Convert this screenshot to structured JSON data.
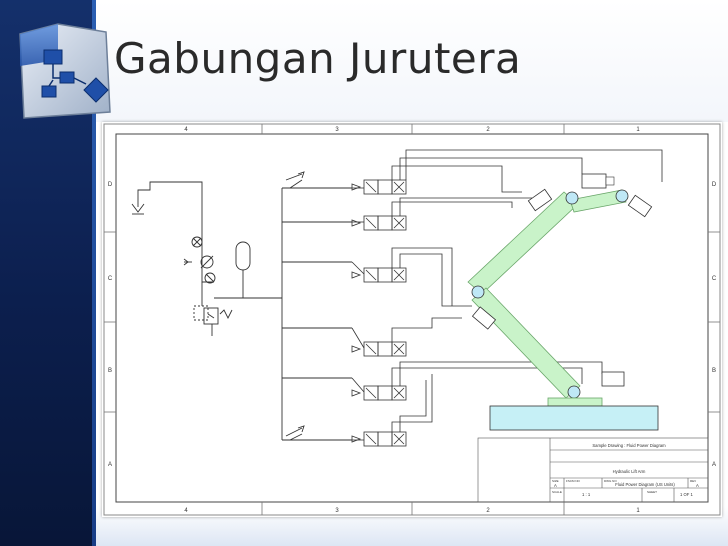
{
  "slide": {
    "title": "Gabungan Jurutera",
    "logo_icon": "diagram-document-icon",
    "accent_color": "#14306b"
  },
  "drawing": {
    "zone_columns": [
      "4",
      "3",
      "2",
      "1"
    ],
    "zone_rows": [
      "D",
      "C",
      "B",
      "A"
    ],
    "title_block": {
      "line1": "Sample Drawing : Fluid Power Diagram",
      "line2": "Hydraulic Lift Arm",
      "size_label": "SIZE",
      "fscm_label": "FSCM NO",
      "dwg_label": "DWG NO",
      "rev_label": "REV",
      "dwg_no": "Fluid Power Diagram (US Units)",
      "size": "A",
      "rev": "A",
      "scale_label": "SCALE",
      "scale": "1 : 1",
      "sheet_label": "SHEET",
      "sheet": "1 OF 1"
    }
  }
}
